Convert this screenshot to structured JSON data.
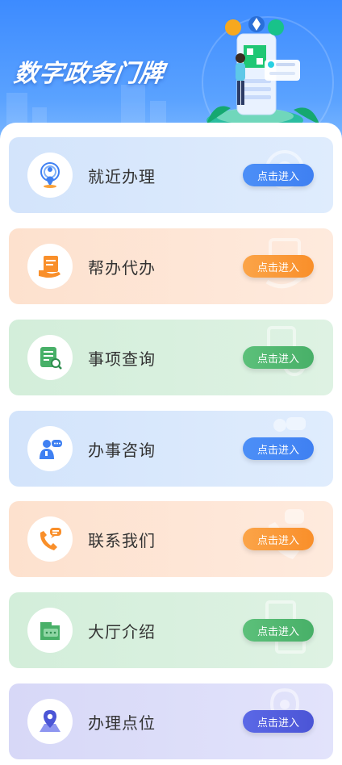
{
  "header": {
    "title": "数字政务门牌"
  },
  "colors": {
    "header_blue": "#3d8bff",
    "blue": "#3f80f2",
    "orange": "#f98f2a",
    "green": "#48b068",
    "purple": "#4b55d6"
  },
  "services": [
    {
      "label": "就近办理",
      "button": "点击进入",
      "icon": "location-person-icon",
      "theme": "blue"
    },
    {
      "label": "帮办代办",
      "button": "点击进入",
      "icon": "document-hand-icon",
      "theme": "orange"
    },
    {
      "label": "事项查询",
      "button": "点击进入",
      "icon": "document-search-icon",
      "theme": "green"
    },
    {
      "label": "办事咨询",
      "button": "点击进入",
      "icon": "consult-person-icon",
      "theme": "blue"
    },
    {
      "label": "联系我们",
      "button": "点击进入",
      "icon": "phone-chat-icon",
      "theme": "orange"
    },
    {
      "label": "大厅介绍",
      "button": "点击进入",
      "icon": "hall-chat-icon",
      "theme": "green"
    },
    {
      "label": "办理点位",
      "button": "点击进入",
      "icon": "map-pin-icon",
      "theme": "purple"
    }
  ]
}
